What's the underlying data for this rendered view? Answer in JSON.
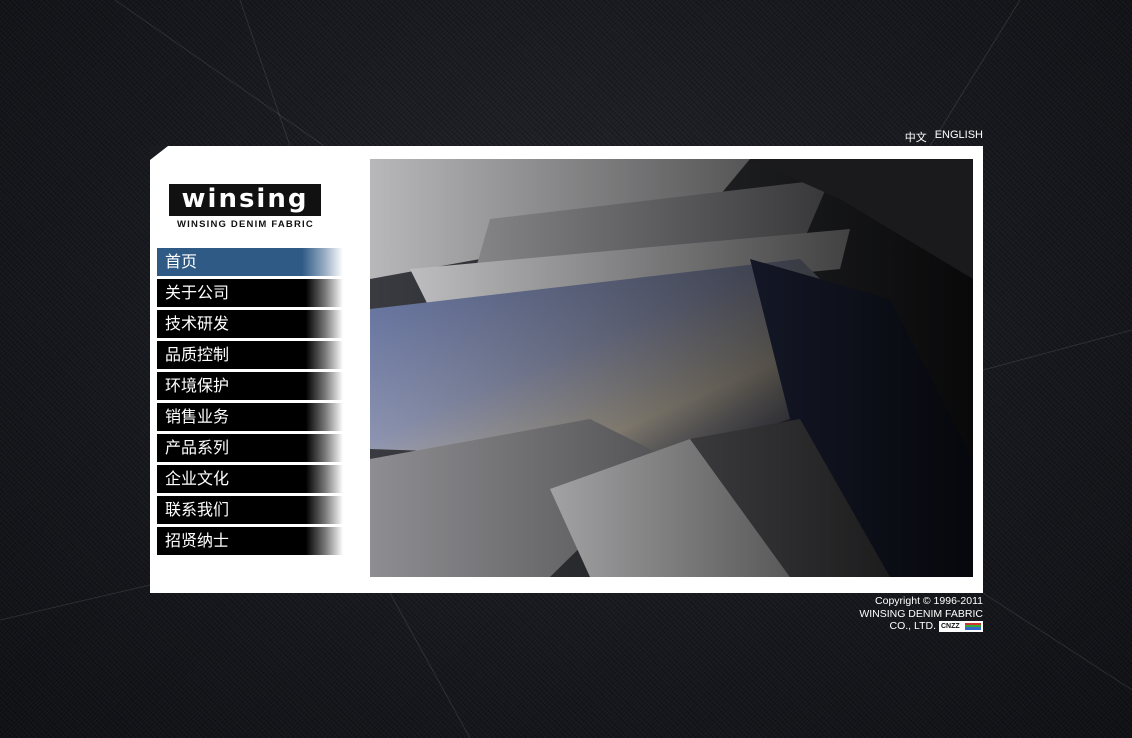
{
  "language": {
    "chinese": "中文",
    "english": "ENGLISH"
  },
  "logo": {
    "wordmark": "winsing",
    "tagline": "WINSING DENIM FABRIC"
  },
  "nav": {
    "items": [
      {
        "label": "首页",
        "active": true
      },
      {
        "label": "关于公司",
        "active": false
      },
      {
        "label": "技术研发",
        "active": false
      },
      {
        "label": "品质控制",
        "active": false
      },
      {
        "label": "环境保护",
        "active": false
      },
      {
        "label": "销售业务",
        "active": false
      },
      {
        "label": "产品系列",
        "active": false
      },
      {
        "label": "企业文化",
        "active": false
      },
      {
        "label": "联系我们",
        "active": false
      },
      {
        "label": "招贤纳士",
        "active": false
      }
    ]
  },
  "footer": {
    "copyright": "Copyright © 1996-2011",
    "company_line1": "WINSING DENIM FABRIC",
    "company_line2": "CO., LTD.",
    "badge": "CNZZ"
  },
  "colors": {
    "nav_active": "#2f5a86",
    "nav_default": "#000000",
    "panel": "#ffffff",
    "background": "#16171c"
  }
}
